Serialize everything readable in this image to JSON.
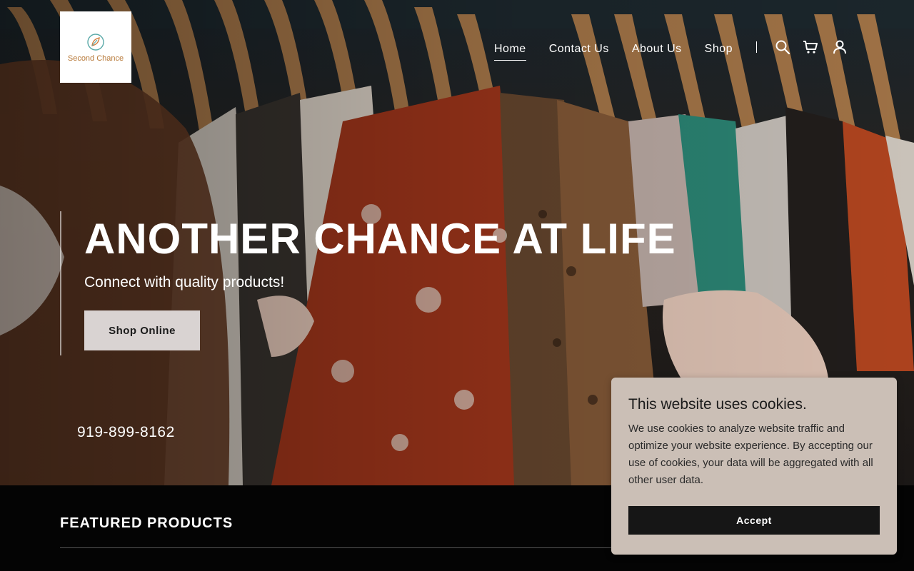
{
  "logo": {
    "text": "Second Chance"
  },
  "nav": {
    "items": [
      {
        "label": "Home",
        "active": true
      },
      {
        "label": "Contact Us",
        "active": false
      },
      {
        "label": "About Us",
        "active": false
      },
      {
        "label": "Shop",
        "active": false
      }
    ],
    "icons": [
      "search-icon",
      "cart-icon",
      "account-icon"
    ]
  },
  "hero": {
    "title": "ANOTHER CHANCE AT LIFE",
    "subtitle": "Connect with quality products!",
    "cta_label": "Shop Online",
    "phone": "919-899-8162"
  },
  "featured": {
    "title": "FEATURED PRODUCTS"
  },
  "cookie_banner": {
    "title": "This website uses cookies.",
    "body": "We use cookies to analyze website traffic and optimize your website experience. By accepting our use of cookies, your data will be aggregated with all other user data.",
    "accept_label": "Accept"
  },
  "colors": {
    "cta_background": "#d9d3d2",
    "cookie_background": "#cbbfb6",
    "accept_background": "#161616",
    "logo_text": "#b87a3a"
  }
}
